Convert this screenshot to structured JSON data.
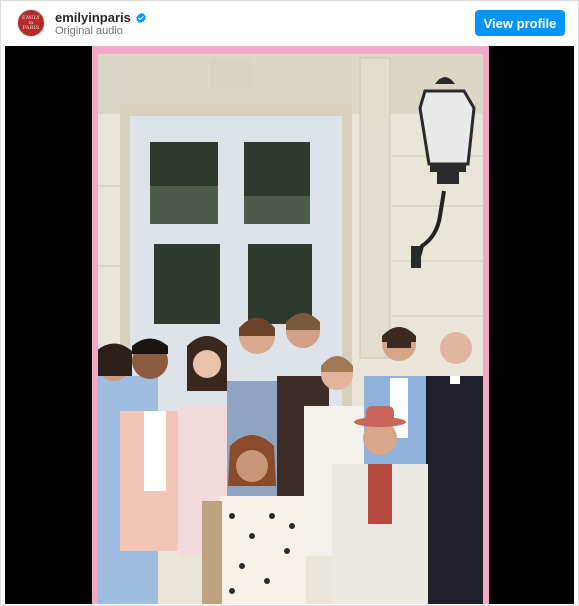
{
  "header": {
    "avatar_text": [
      "EMILY",
      "in",
      "PARIS"
    ],
    "username": "emilyinparis",
    "verified_icon": "verified-badge-icon",
    "subtitle": "Original audio",
    "view_profile_label": "View profile"
  },
  "colors": {
    "accent": "#0095f6",
    "frame_pink": "#f2a9c7",
    "avatar_red": "#b32b2b"
  },
  "media": {
    "type": "video",
    "description_icon": "group-photo"
  }
}
